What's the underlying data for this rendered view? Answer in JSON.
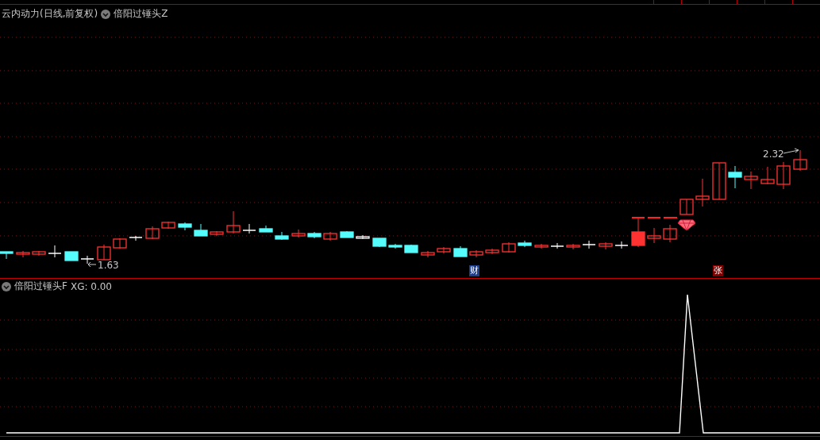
{
  "main_panel": {
    "stock_title": "云内动力(日线,前复权)",
    "formula_name": "倍阳过锤头Z",
    "high_label": "2.32",
    "low_label": "1.63",
    "markers": [
      {
        "text": "财",
        "kind": "finance"
      },
      {
        "text": "张",
        "kind": "limit"
      }
    ]
  },
  "indicator_panel": {
    "formula_name": "倍阳过锤头F",
    "reading": "XG: 0.00"
  }
}
